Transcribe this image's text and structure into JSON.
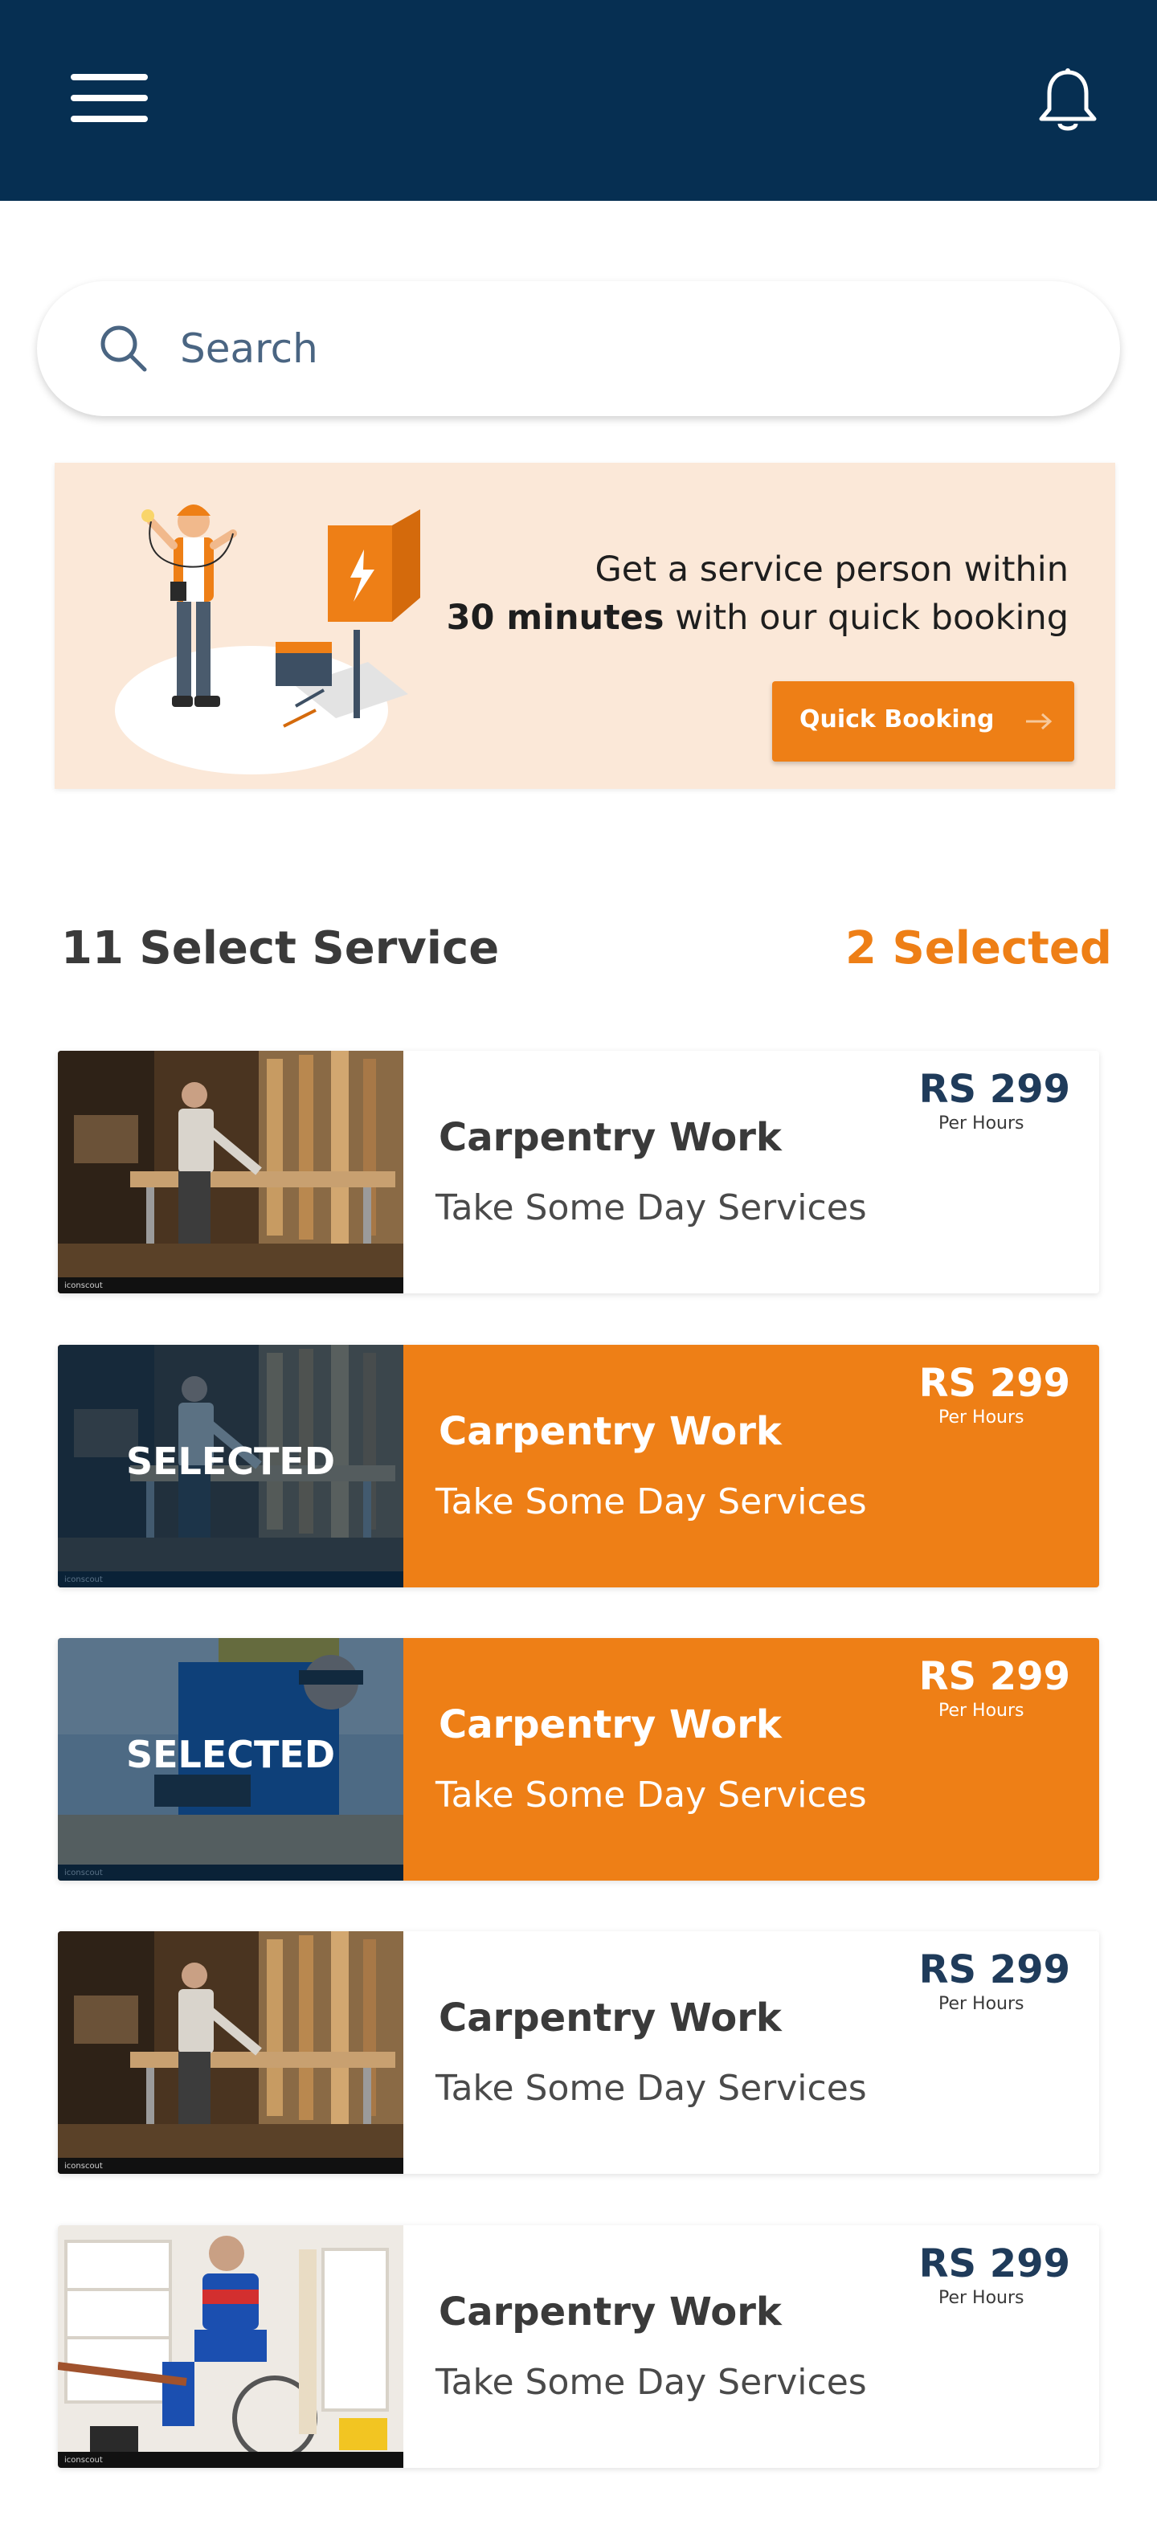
{
  "header": {
    "menu_icon": "hamburger-menu-icon",
    "bell_icon": "bell-icon",
    "background": "#062f52"
  },
  "search": {
    "placeholder": "Search",
    "icon": "search-icon"
  },
  "banner": {
    "line1": "Get a service person within",
    "line2_bold": "30 minutes",
    "line2_rest": " with our quick booking",
    "button_label": "Quick Booking",
    "button_icon": "arrow-right-icon",
    "accent": "#ee7f16"
  },
  "services_header": {
    "title": "11 Select Service",
    "selected": "2 Selected"
  },
  "services": [
    {
      "title": "Carpentry Work",
      "subtitle": "Take Some Day Services",
      "price": "RS 299",
      "unit": "Per Hours",
      "selected": false,
      "thumb": "carpenter"
    },
    {
      "title": "Carpentry Work",
      "subtitle": "Take Some Day Services",
      "price": "RS 299",
      "unit": "Per Hours",
      "selected": true,
      "selected_label": "SELECTED",
      "thumb": "carpenter"
    },
    {
      "title": "Carpentry Work",
      "subtitle": "Take Some Day Services",
      "price": "RS 299",
      "unit": "Per Hours",
      "selected": true,
      "selected_label": "SELECTED",
      "thumb": "worker"
    },
    {
      "title": "Carpentry Work",
      "subtitle": "Take Some Day Services",
      "price": "RS 299",
      "unit": "Per Hours",
      "selected": false,
      "thumb": "carpenter"
    },
    {
      "title": "Carpentry Work",
      "subtitle": "Take Some Day Services",
      "price": "RS 299",
      "unit": "Per Hours",
      "selected": false,
      "thumb": "handyman"
    }
  ],
  "watermark": "iconscout"
}
